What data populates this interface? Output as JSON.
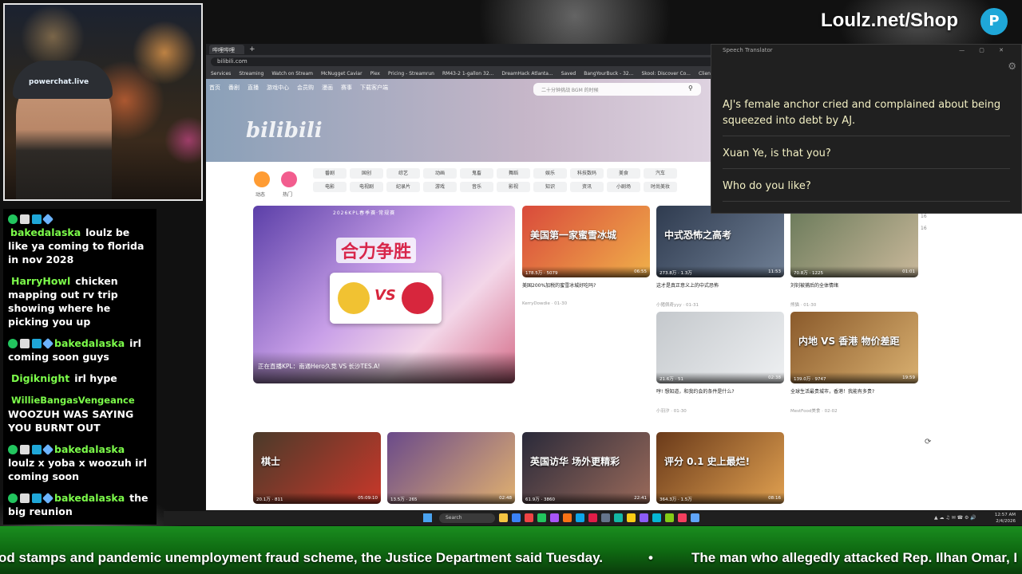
{
  "overlay": {
    "brand": "Loulz.net/Shop",
    "brand_icon": "P",
    "webcam_cap_text": "powerchat.live"
  },
  "chat": {
    "messages": [
      {
        "user": "bakedalaska",
        "user_color": "#7CFC4A",
        "badges": true,
        "text": "loulz be like ya coming to florida in nov 2028"
      },
      {
        "user": "HarryHowl",
        "user_color": "#7CFC4A",
        "badges": false,
        "text": "chicken mapping out rv trip showing where he picking you up"
      },
      {
        "user": "bakedalaska",
        "user_color": "#7CFC4A",
        "badges": true,
        "text": "irl coming soon guys"
      },
      {
        "user": "Digiknight",
        "user_color": "#7CFC4A",
        "badges": false,
        "text": "irl hype"
      },
      {
        "user": "WillieBangasVengeance",
        "user_color": "#7CFC4A",
        "badges": false,
        "text": "WOOZUH WAS SAYING YOU BURNT OUT"
      },
      {
        "user": "bakedalaska",
        "user_color": "#7CFC4A",
        "badges": true,
        "text": "loulz x yoba x woozuh irl coming soon"
      },
      {
        "user": "bakedalaska",
        "user_color": "#7CFC4A",
        "badges": true,
        "text": "the big reunion"
      }
    ]
  },
  "browser": {
    "tab_label": "哔哩哔哩",
    "tab_new": "+",
    "url": "bilibili.com",
    "bookmarks": [
      "Services",
      "Streaming",
      "Watch on Stream",
      "McNugget Caviar",
      "Plex",
      "Pricing - Streamrun",
      "RM43-2 1-gallon 32...",
      "DreamHack Atlanta...",
      "Saved",
      "BangYourBuck - 32...",
      "Skool: Discover Co...",
      "Client Area - AntiSc..."
    ],
    "nav": [
      "首页",
      "番剧",
      "直播",
      "游戏中心",
      "会员购",
      "漫画",
      "赛事",
      "下载客户端"
    ],
    "search_placeholder": "二十分钟挑战 BGM 的时候",
    "logo": "bilibili",
    "channel_hot": "热门",
    "channel_dynamic": "动态",
    "channels": [
      "番剧",
      "国创",
      "综艺",
      "动画",
      "鬼畜",
      "舞蹈",
      "娱乐",
      "科技数码",
      "美食",
      "汽车",
      "电影",
      "电视剧",
      "纪录片",
      "游戏",
      "音乐",
      "影视",
      "知识",
      "资讯",
      "小剧场",
      "时尚美妆"
    ],
    "feature": {
      "head": "2026KPL春季赛·常规赛",
      "title": "合力争胜",
      "vs": "VS",
      "caption": "正在直播KPL：南通Hero久竞 VS 长沙TES.A!"
    },
    "cards": [
      {
        "overlay": "美国第一家蜜雪冰城",
        "views": "178.5万",
        "danmaku": "5079",
        "duration": "06:55",
        "title": "美国200%加税的蜜雪冰城好吃吗?",
        "uploader": "KerryDowdie · 01-30",
        "c1": "#d94a3b",
        "c2": "#f0b04a"
      },
      {
        "overlay": "中式恐怖之高考",
        "views": "273.8万",
        "danmaku": "1.3万",
        "duration": "11:53",
        "title": "这才是真正意义上的中式恐怖",
        "uploader": "小猪佩奇yyy · 01-31",
        "c1": "#2f3b4f",
        "c2": "#6f7f95"
      },
      {
        "overlay": "",
        "views": "70.8万",
        "danmaku": "1225",
        "duration": "01:01",
        "title": "刘钊被捕后的全体情绪",
        "uploader": "熊猫 · 01-30",
        "c1": "#6a7a5a",
        "c2": "#c9b89a"
      },
      {
        "overlay": "",
        "views": "21.6万",
        "danmaku": "51",
        "duration": "02:38",
        "title": "哼! 想知道，和我约会的条件是什么?",
        "uploader": "小羽汐 · 01-30",
        "c1": "#c4c8cc",
        "c2": "#eef0f2"
      },
      {
        "overlay": "内地 VS 香港 物价差距",
        "views": "139.0万",
        "danmaku": "9747",
        "duration": "19:59",
        "title": "全球生活最贵城市，香港！我能有多贵?",
        "uploader": "MestFood美食 · 02-02",
        "c1": "#8a5a2b",
        "c2": "#d9b070"
      },
      {
        "overlay": "棋士",
        "views": "20.1万",
        "danmaku": "811",
        "duration": "05:09:10",
        "title": "",
        "uploader": "",
        "c1": "#4a3a2a",
        "c2": "#c9382a"
      },
      {
        "overlay": "",
        "views": "13.5万",
        "danmaku": "265",
        "duration": "02:48",
        "title": "",
        "uploader": "",
        "c1": "#6a4a8a",
        "c2": "#e0b070"
      },
      {
        "overlay": "英国访华 场外更精彩",
        "views": "61.9万",
        "danmaku": "3860",
        "duration": "22:41",
        "title": "",
        "uploader": "",
        "c1": "#2a2a3a",
        "c2": "#9a6a5a"
      },
      {
        "overlay": "评分 0.1 史上最烂!",
        "views": "364.3万",
        "danmaku": "1.5万",
        "duration": "08:16",
        "title": "",
        "uploader": "",
        "c1": "#6a3a1a",
        "c2": "#e0a050"
      }
    ],
    "rightbar": [
      "16",
      "16"
    ]
  },
  "translator": {
    "title": "Speech Translator",
    "controls": "— ▢ ✕",
    "lines": [
      "AJ's female anchor cried and complained about being squeezed into debt by AJ.",
      "Xuan Ye, is that you?",
      "Who do you like?"
    ]
  },
  "taskbar": {
    "search": "Search",
    "time": "12:57 AM",
    "date": "2/4/2026"
  },
  "ticker": {
    "item1": "od stamps and pandemic unemployment fraud scheme, the Justice Department said Tuesday.",
    "separator": "•",
    "item2": "The man who allegedly attacked Rep. Ilhan Omar, I"
  }
}
